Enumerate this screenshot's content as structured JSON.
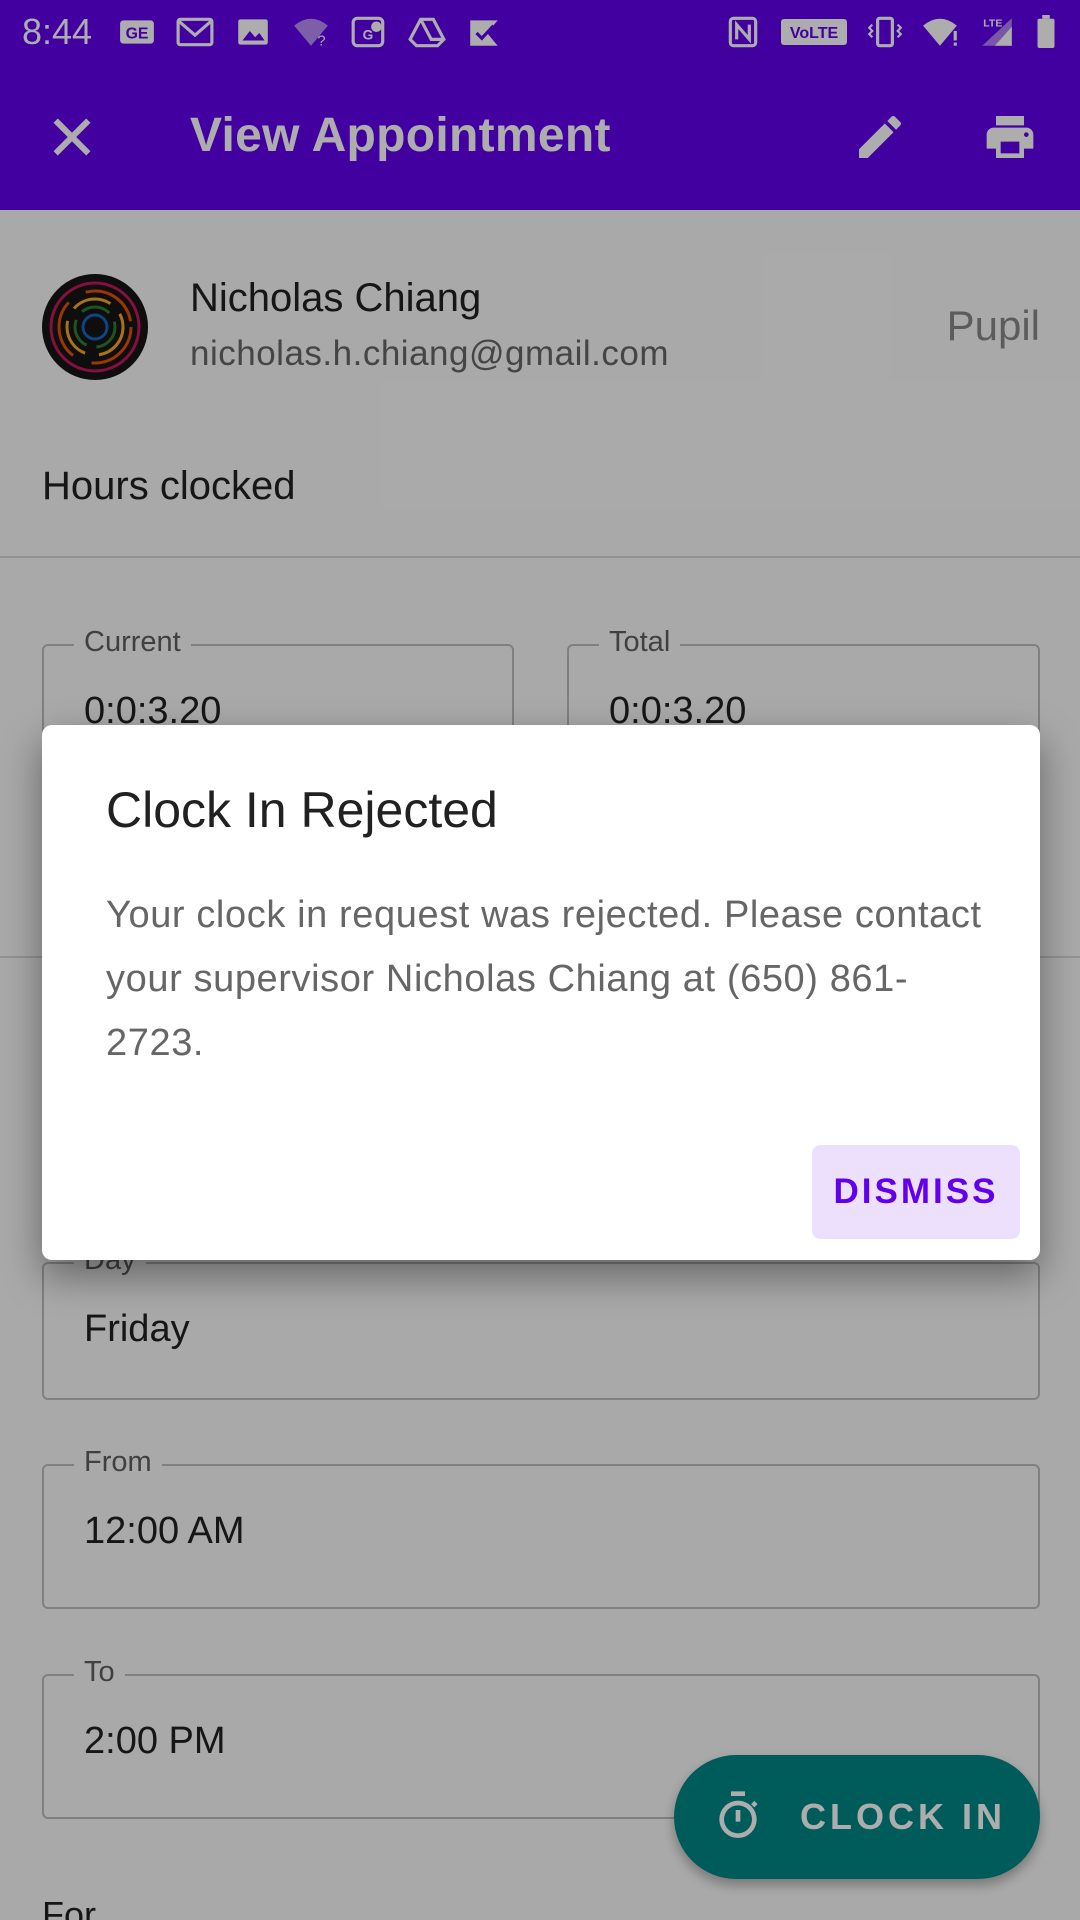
{
  "status_bar": {
    "time": "8:44",
    "left_icons": [
      "gmail-shortcut-icon",
      "gmail-icon",
      "photos-icon",
      "wifi-question-icon",
      "maps-icon",
      "drive-icon",
      "tasks-icon"
    ],
    "right_icons": [
      "nfc-icon",
      "volte-icon",
      "vibrate-icon",
      "wifi-icon",
      "signal-icon",
      "battery-icon"
    ],
    "volte_label": "VoLTE",
    "lte_label": "LTE",
    "bg_color": "#6200ee"
  },
  "app_bar": {
    "title": "View Appointment",
    "close_icon": "close-icon",
    "edit_icon": "edit-icon",
    "print_icon": "print-icon"
  },
  "user": {
    "name": "Nicholas Chiang",
    "email": "nicholas.h.chiang@gmail.com",
    "role": "Pupil"
  },
  "hours": {
    "section_label": "Hours clocked",
    "current_label": "Current",
    "current_value": "0:0:3.20",
    "total_label": "Total",
    "total_value": "0:0:3.20"
  },
  "fields": {
    "day_label": "Day",
    "day_value": "Friday",
    "from_label": "From",
    "from_value": "12:00 AM",
    "to_label": "To",
    "to_value": "2:00 PM",
    "for_label": "For"
  },
  "fab": {
    "label": "CLOCK IN",
    "icon": "timer-icon",
    "color": "#018786"
  },
  "dialog": {
    "title": "Clock In Rejected",
    "message": "Your clock in request was rejected. Please contact your supervisor Nicholas Chiang at (650) 861-2723.",
    "dismiss_label": "DISMISS",
    "accent": "#6200ee"
  }
}
